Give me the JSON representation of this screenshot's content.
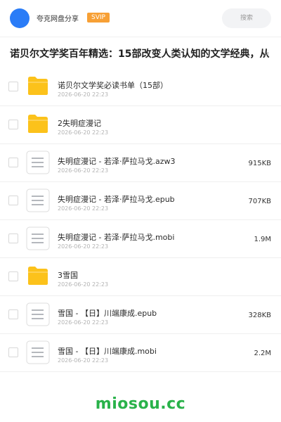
{
  "header": {
    "brand": "夸克网盘分享",
    "badge": "SVIP",
    "search_label": "搜索"
  },
  "title": {
    "text": "诺贝尔文学奖百年精选：15部改变人类认知的文学经典，从",
    "overflow": "M"
  },
  "files": [
    {
      "type": "folder",
      "name": "诺贝尔文学奖必读书单（15部）",
      "date": "2026-06-20 22:23",
      "size": ""
    },
    {
      "type": "folder",
      "name": "2失明症漫记",
      "date": "2026-06-20 22:23",
      "size": ""
    },
    {
      "type": "file",
      "name": "失明症漫记 - 若泽·萨拉马戈.azw3",
      "date": "2026-06-20 22:23",
      "size": "915KB"
    },
    {
      "type": "file",
      "name": "失明症漫记 - 若泽·萨拉马戈.epub",
      "date": "2026-06-20 22:23",
      "size": "707KB"
    },
    {
      "type": "file",
      "name": "失明症漫记 - 若泽·萨拉马戈.mobi",
      "date": "2026-06-20 22:23",
      "size": "1.9M"
    },
    {
      "type": "folder",
      "name": "3雪国",
      "date": "2026-06-20 22:23",
      "size": ""
    },
    {
      "type": "file",
      "name": "雪国 - 【日】川端康成.epub",
      "date": "2026-06-20 22:23",
      "size": "328KB"
    },
    {
      "type": "file",
      "name": "雪国 - 【日】川端康成.mobi",
      "date": "2026-06-20 22:23",
      "size": "2.2M"
    }
  ],
  "watermark": "miosou.cc",
  "colors": {
    "accent": "#2a7cf7",
    "badge": "#f7a035",
    "folder": "#fcc21b",
    "watermark": "#29b24a"
  },
  "icons": {
    "folder": "folder-icon",
    "file": "document-icon"
  }
}
